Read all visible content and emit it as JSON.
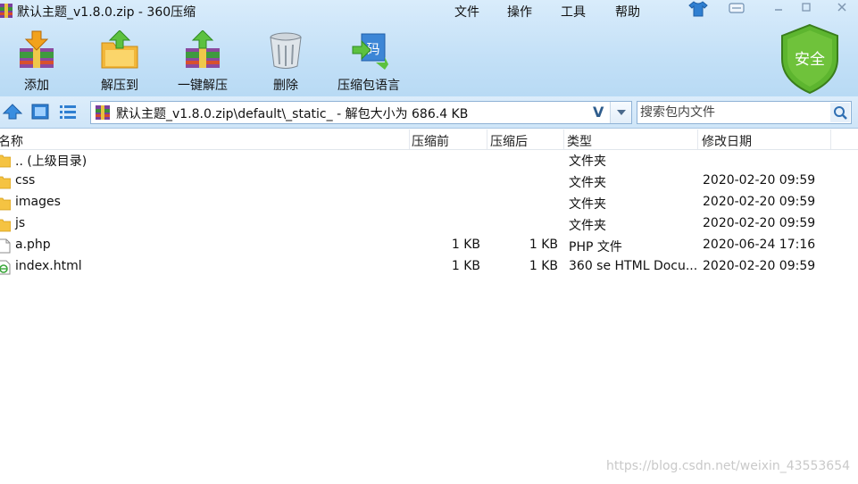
{
  "window": {
    "title": "默认主题_v1.8.0.zip - 360压缩",
    "menu": [
      "文件",
      "操作",
      "工具",
      "帮助"
    ]
  },
  "toolbar": {
    "add_label": "添加",
    "extract_to_label": "解压到",
    "one_click_extract_label": "一键解压",
    "delete_label": "删除",
    "language_label": "压缩包语言",
    "safe_badge": "安全"
  },
  "address": {
    "path": "默认主题_v1.8.0.zip\\default\\_static_ - 解包大小为 686.4 KB",
    "v_glyph": "V"
  },
  "search": {
    "placeholder": "搜索包内文件"
  },
  "columns": {
    "name": "名称",
    "packed": "压缩前",
    "size": "压缩后",
    "type": "类型",
    "modified": "修改日期"
  },
  "files": [
    {
      "name": ".. (上级目录)",
      "packed": "",
      "size": "",
      "type": "文件夹",
      "modified": "",
      "icon": "folder-icon"
    },
    {
      "name": "css",
      "packed": "",
      "size": "",
      "type": "文件夹",
      "modified": "2020-02-20 09:59",
      "icon": "folder-icon"
    },
    {
      "name": "images",
      "packed": "",
      "size": "",
      "type": "文件夹",
      "modified": "2020-02-20 09:59",
      "icon": "folder-icon"
    },
    {
      "name": "js",
      "packed": "",
      "size": "",
      "type": "文件夹",
      "modified": "2020-02-20 09:59",
      "icon": "folder-icon"
    },
    {
      "name": "a.php",
      "packed": "1 KB",
      "size": "1 KB",
      "type": "PHP 文件",
      "modified": "2020-06-24 17:16",
      "icon": "file-icon"
    },
    {
      "name": "index.html",
      "packed": "1 KB",
      "size": "1 KB",
      "type": "360 se HTML Docu...",
      "modified": "2020-02-20 09:59",
      "icon": "html-file-icon"
    }
  ],
  "watermark": "https://blog.csdn.net/weixin_43553654",
  "colors": {
    "chrome_top": "#d9ecfb",
    "chrome_bottom": "#b8daf4",
    "folder": "#f5c342",
    "shield_green": "#4fa626"
  }
}
